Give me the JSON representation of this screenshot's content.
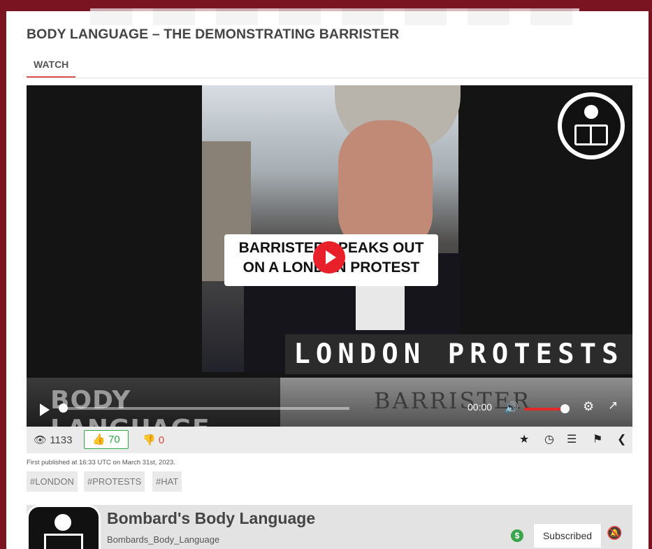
{
  "page": {
    "title": "BODY LANGUAGE – THE DEMONSTRATING BARRISTER",
    "tabs": [
      {
        "label": "WATCH",
        "active": true
      }
    ]
  },
  "video": {
    "banner_line1": "BARRISTER SPEAKS OUT",
    "banner_line2": "ON A LONDON PROTEST",
    "strip_text": "LONDON PROTESTS",
    "lower_left_text": "BODY LANGUAGE",
    "lower_right_text": "BARRISTER",
    "time": "00:00",
    "progress": 0.0,
    "volume": 1.0
  },
  "stats": {
    "views": "1133",
    "likes": "70",
    "dislikes": "0"
  },
  "meta": {
    "published": "First published at 16:33 UTC on March 31st, 2023.",
    "tags": [
      "#LONDON",
      "#PROTESTS",
      "#HAT"
    ]
  },
  "channel": {
    "name": "Bombard's Body Language",
    "handle": "Bombards_Body_Language",
    "subscribe_label": "Subscribed",
    "money_label": "$"
  },
  "icons": {
    "eye": "eye-icon",
    "thumbs_up": "thumbs-up-icon",
    "thumbs_down": "thumbs-down-icon",
    "star": "star-icon",
    "clock": "clock-icon",
    "list": "list-icon",
    "flag": "flag-icon",
    "share": "share-icon",
    "bell_off": "bell-off-icon"
  },
  "colors": {
    "frame": "#7a1421",
    "accent_red": "#e8202a",
    "like_green": "#2eaa44",
    "dislike_red": "#e04a3f"
  }
}
